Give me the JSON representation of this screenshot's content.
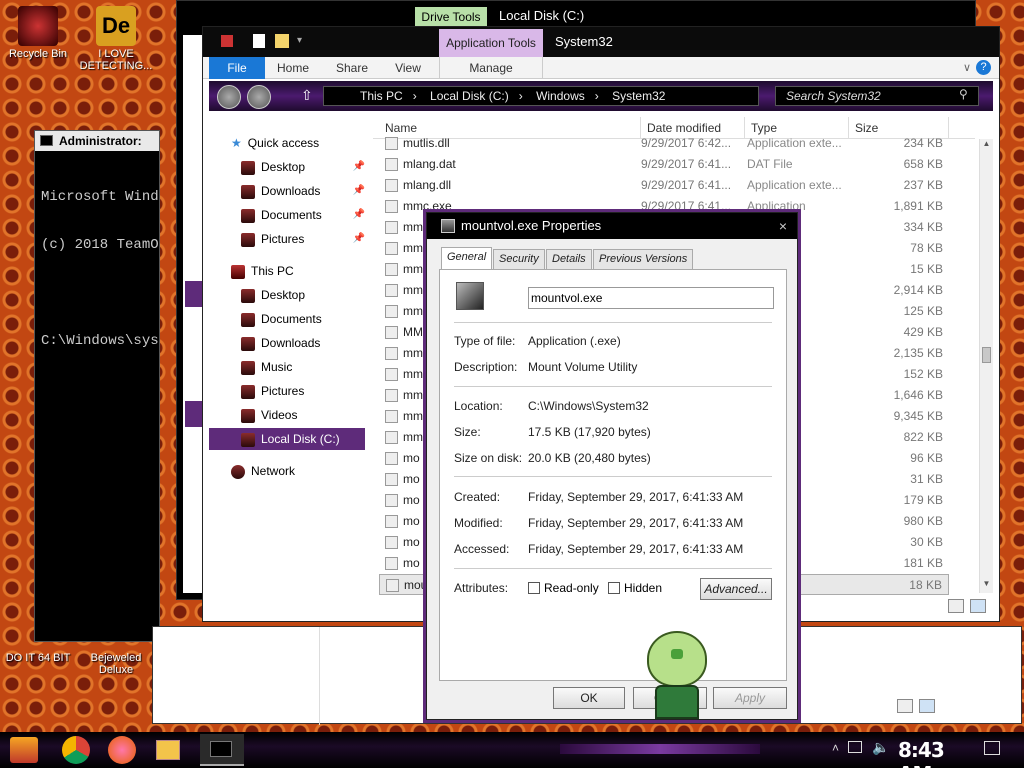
{
  "desktop_icons": [
    {
      "label": "Recycle Bin",
      "color": "#7a1a1a"
    },
    {
      "label": "I LOVE DETECTING...",
      "color": "#d9a020"
    },
    {
      "label": "DO IT 64 BIT",
      "color": "#8a4b4b"
    },
    {
      "label": "Bejeweled Deluxe",
      "color": "#9a7a7a"
    }
  ],
  "explorer_back": {
    "ribbon_tab": "Drive Tools",
    "title": "Local Disk (C:)"
  },
  "explorer": {
    "ribbon_context_tab": "Application Tools",
    "title": "System32",
    "tabs": [
      "File",
      "Home",
      "Share",
      "View",
      "Manage"
    ],
    "breadcrumb": [
      "This PC",
      "Local Disk (C:)",
      "Windows",
      "System32"
    ],
    "search_placeholder": "Search System32",
    "nav": [
      {
        "label": "Quick access",
        "pinned": false
      },
      {
        "label": "Desktop",
        "pinned": true
      },
      {
        "label": "Downloads",
        "pinned": true
      },
      {
        "label": "Documents",
        "pinned": true
      },
      {
        "label": "Pictures",
        "pinned": true
      },
      {
        "label": "This PC",
        "pinned": false
      },
      {
        "label": "Desktop",
        "pinned": false
      },
      {
        "label": "Documents",
        "pinned": false
      },
      {
        "label": "Downloads",
        "pinned": false
      },
      {
        "label": "Music",
        "pinned": false
      },
      {
        "label": "Pictures",
        "pinned": false
      },
      {
        "label": "Videos",
        "pinned": false
      },
      {
        "label": "Local Disk (C:)",
        "pinned": false
      },
      {
        "label": "Network",
        "pinned": false
      }
    ],
    "pin_icon": "📌",
    "columns": [
      "Name",
      "Date modified",
      "Type",
      "Size"
    ],
    "rows": [
      {
        "name": "mutlis.dll",
        "date": "9/29/2017 6:42...",
        "type": "Application exte...",
        "size": "234 KB"
      },
      {
        "name": "mlang.dat",
        "date": "9/29/2017 6:41...",
        "type": "DAT File",
        "size": "658 KB"
      },
      {
        "name": "mlang.dll",
        "date": "9/29/2017 6:41...",
        "type": "Application exte...",
        "size": "237 KB"
      },
      {
        "name": "mmc.exe",
        "date": "9/29/2017 6:41...",
        "type": "Application",
        "size": "1,891 KB"
      },
      {
        "name": "mm",
        "date": "",
        "type": "exte...",
        "size": "334 KB"
      },
      {
        "name": "mm",
        "date": "",
        "type": "exte...",
        "size": "78 KB"
      },
      {
        "name": "mm",
        "date": "",
        "type": "exte...",
        "size": "15 KB"
      },
      {
        "name": "mm",
        "date": "",
        "type": "exte...",
        "size": "2,914 KB"
      },
      {
        "name": "mm",
        "date": "",
        "type": "exte...",
        "size": "125 KB"
      },
      {
        "name": "MM",
        "date": "",
        "type": "exte...",
        "size": "429 KB"
      },
      {
        "name": "mm",
        "date": "",
        "type": "exte...",
        "size": "2,135 KB"
      },
      {
        "name": "mm",
        "date": "",
        "type": "exte...",
        "size": "152 KB"
      },
      {
        "name": "mm",
        "date": "",
        "type": "",
        "size": "1,646 KB"
      },
      {
        "name": "mm",
        "date": "",
        "type": "exte...",
        "size": "9,345 KB"
      },
      {
        "name": "mm",
        "date": "",
        "type": "el item",
        "size": "822 KB"
      },
      {
        "name": "mo",
        "date": "",
        "type": "",
        "size": "96 KB"
      },
      {
        "name": "mo",
        "date": "",
        "type": "plicat...",
        "size": "31 KB"
      },
      {
        "name": "mo",
        "date": "",
        "type": "exte...",
        "size": "179 KB"
      },
      {
        "name": "mo",
        "date": "",
        "type": "exte...",
        "size": "980 KB"
      },
      {
        "name": "mo",
        "date": "",
        "type": "plicat...",
        "size": "30 KB"
      },
      {
        "name": "mo",
        "date": "",
        "type": "exte...",
        "size": "181 KB"
      },
      {
        "name": "mou",
        "date": "",
        "type": "",
        "size": "18 KB"
      }
    ]
  },
  "cmd": {
    "title": "Administrator:",
    "lines": [
      "Microsoft Wind",
      "(c) 2018 TeamO",
      "",
      "C:\\Windows\\sys"
    ]
  },
  "dialog": {
    "title": "mountvol.exe Properties",
    "tabs": [
      "General",
      "Security",
      "Details",
      "Previous Versions"
    ],
    "filename": "mountvol.exe",
    "type_label": "Type of file:",
    "type_value": "Application (.exe)",
    "desc_label": "Description:",
    "desc_value": "Mount Volume Utility",
    "loc_label": "Location:",
    "loc_value": "C:\\Windows\\System32",
    "size_label": "Size:",
    "size_value": "17.5 KB (17,920 bytes)",
    "disk_label": "Size on disk:",
    "disk_value": "20.0 KB (20,480 bytes)",
    "created_label": "Created:",
    "created_value": "Friday, September 29, 2017, 6:41:33 AM",
    "modified_label": "Modified:",
    "modified_value": "Friday, September 29, 2017, 6:41:33 AM",
    "accessed_label": "Accessed:",
    "accessed_value": "Friday, September 29, 2017, 6:41:33 AM",
    "attr_label": "Attributes:",
    "readonly_label": "Read-only",
    "hidden_label": "Hidden",
    "advanced_label": "Advanced...",
    "ok_label": "OK",
    "cancel_label": "Can",
    "apply_label": "Apply"
  },
  "taskbar": {
    "clock": "8:43 AM"
  },
  "colors": {
    "accent_purple": "#5e2b7a",
    "file_tab_blue": "#1a78d6",
    "app_tools_pink": "#d9b8e8",
    "drive_tools_green": "#b8e0a8"
  }
}
